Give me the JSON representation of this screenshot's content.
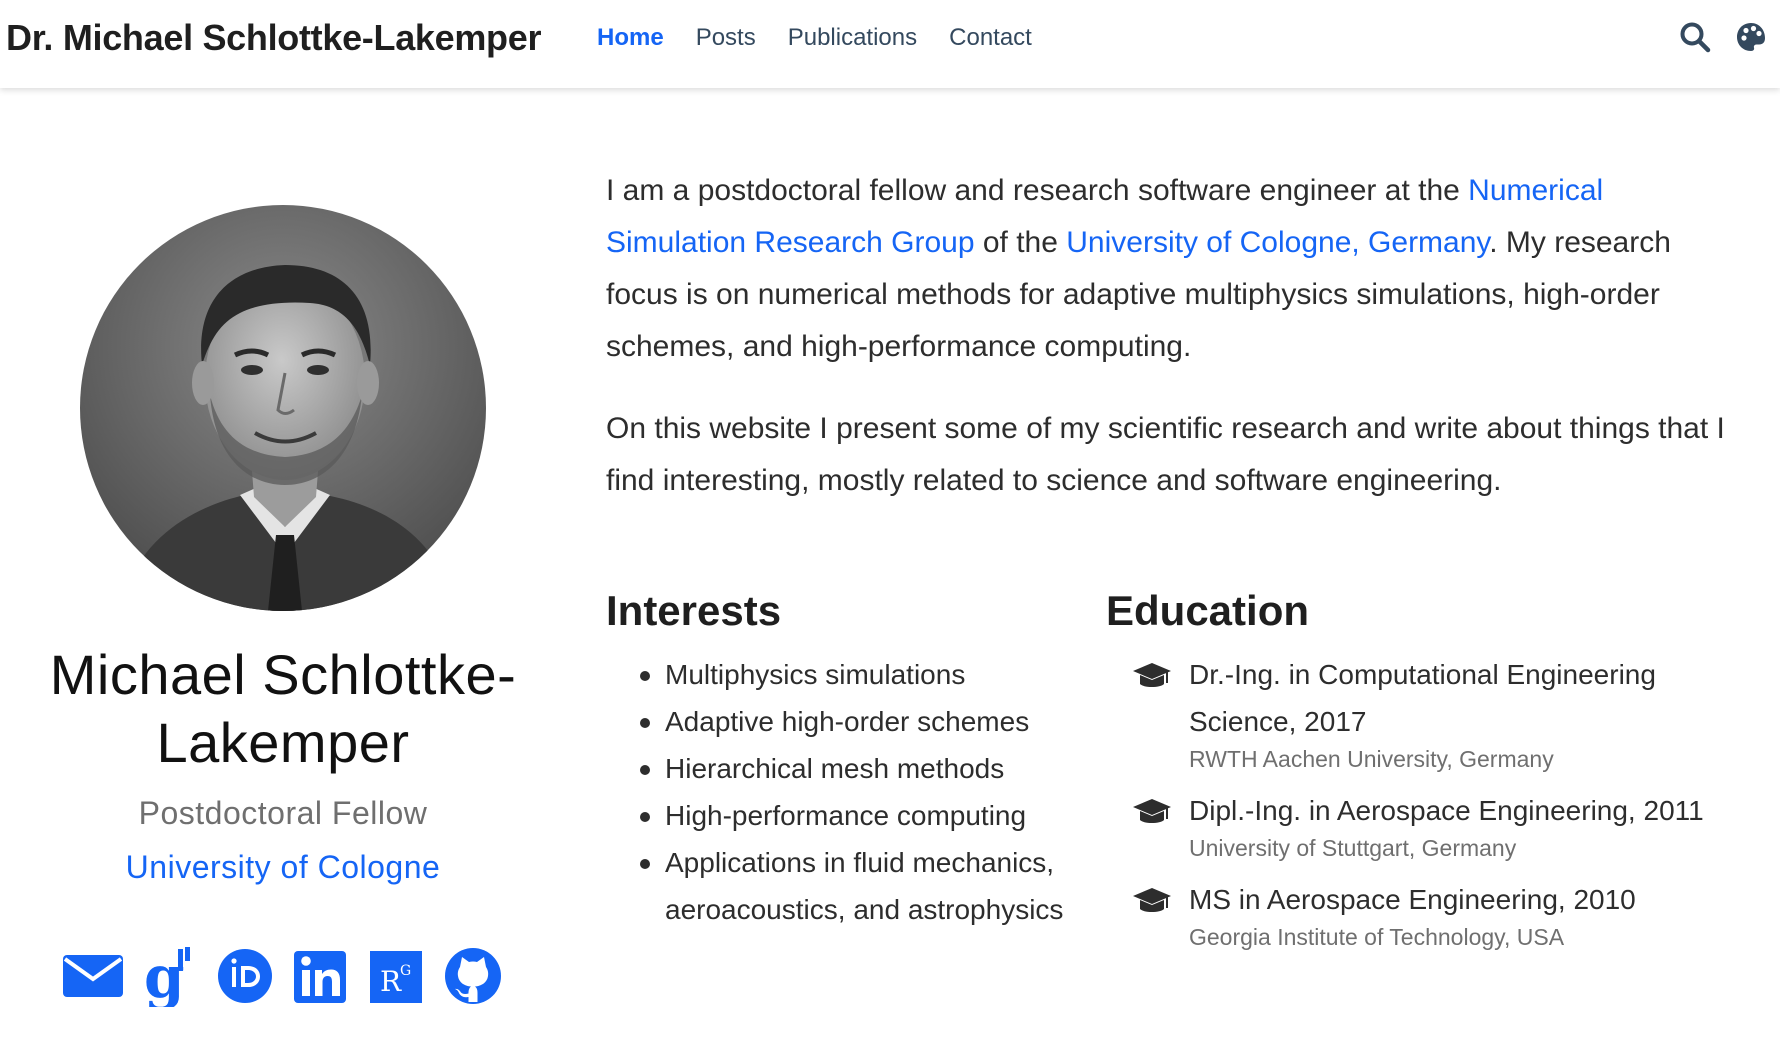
{
  "navbar": {
    "brand": "Dr. Michael Schlottke-Lakemper",
    "links": [
      {
        "label": "Home",
        "active": true
      },
      {
        "label": "Posts",
        "active": false
      },
      {
        "label": "Publications",
        "active": false
      },
      {
        "label": "Contact",
        "active": false
      }
    ],
    "icons": [
      "search-icon",
      "palette-icon"
    ]
  },
  "profile": {
    "name": "Michael Schlottke-Lakemper",
    "role": "Postdoctoral Fellow",
    "organization": "University of Cologne",
    "social_icons": [
      "envelope-icon",
      "google-scholar-icon",
      "orcid-icon",
      "linkedin-icon",
      "researchgate-icon",
      "github-icon"
    ]
  },
  "bio": {
    "p1_text1": "I am a postdoctoral fellow and research software engineer at the ",
    "p1_link1": "Numerical Simulation Research Group",
    "p1_text2": " of the ",
    "p1_link2": "University of Cologne, Germany",
    "p1_text3": ". My research focus is on numerical methods for adaptive multiphysics simulations, high-order schemes, and high-performance computing.",
    "p2": "On this website I present some of my scientific research and write about things that I find interesting, mostly related to science and software engineering."
  },
  "interests": {
    "title": "Interests",
    "items": [
      "Multiphysics simulations",
      "Adaptive high-order schemes",
      "Hierarchical mesh methods",
      "High-performance computing",
      "Applications in fluid mechanics, aeroacoustics, and astrophysics"
    ]
  },
  "education": {
    "title": "Education",
    "items": [
      {
        "degree": "Dr.-Ing. in Computational Engineering Science, 2017",
        "school": "RWTH Aachen University, Germany"
      },
      {
        "degree": "Dipl.-Ing. in Aerospace Engineering, 2011",
        "school": "University of Stuttgart, Germany"
      },
      {
        "degree": "MS in Aerospace Engineering, 2010",
        "school": "Georgia Institute of Technology, USA"
      }
    ]
  },
  "colors": {
    "accent": "#1565f5",
    "text": "#2d2d2d",
    "muted": "#6f6f6f"
  }
}
